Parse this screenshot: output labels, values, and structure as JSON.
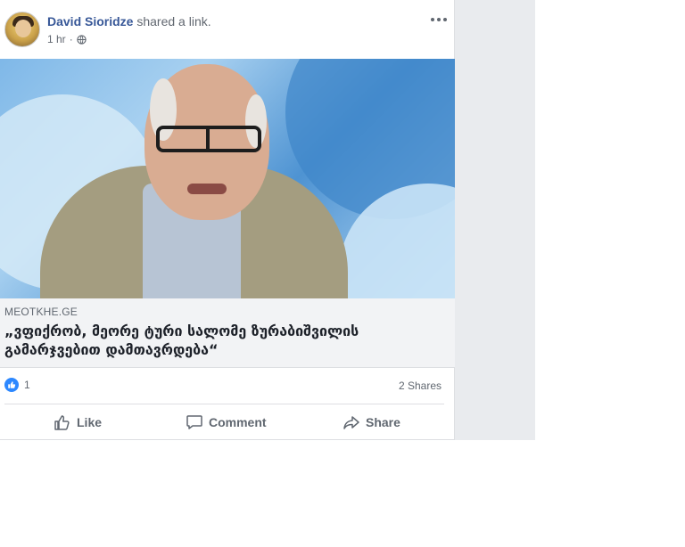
{
  "post": {
    "author": "David Sioridze",
    "action": "shared a link.",
    "time": "1 hr",
    "privacy_icon": "globe-icon",
    "more_icon": "more-icon"
  },
  "link": {
    "source": "MEOTKHE.GE",
    "headline": "„ვფიქრობ, მეორე ტური სალომე ზურაბიშვილის გამარჯვებით დამთავრდება“"
  },
  "stats": {
    "likes": "1",
    "shares": "2 Shares"
  },
  "actions": {
    "like": "Like",
    "comment": "Comment",
    "share": "Share"
  },
  "colors": {
    "link_blue": "#385898",
    "like_blue": "#2d88ff",
    "panel_gray": "#e9ebee"
  }
}
